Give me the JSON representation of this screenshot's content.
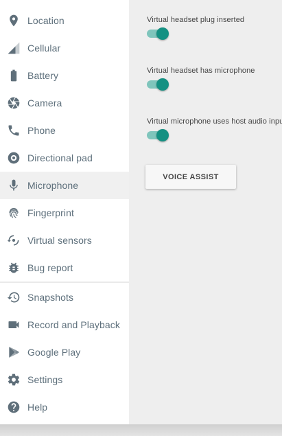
{
  "sidebar": {
    "items": [
      {
        "label": "Location"
      },
      {
        "label": "Cellular"
      },
      {
        "label": "Battery"
      },
      {
        "label": "Camera"
      },
      {
        "label": "Phone"
      },
      {
        "label": "Directional pad"
      },
      {
        "label": "Microphone",
        "selected": true
      },
      {
        "label": "Fingerprint"
      },
      {
        "label": "Virtual sensors"
      },
      {
        "label": "Bug report"
      },
      {
        "label": "Snapshots"
      },
      {
        "label": "Record and Playback"
      },
      {
        "label": "Google Play"
      },
      {
        "label": "Settings"
      },
      {
        "label": "Help"
      }
    ]
  },
  "microphone": {
    "settings": [
      {
        "label": "Virtual headset plug inserted",
        "on": true
      },
      {
        "label": "Virtual headset has microphone",
        "on": true
      },
      {
        "label": "Virtual microphone uses host audio input",
        "on": true
      }
    ],
    "voice_assist_label": "VOICE ASSIST"
  },
  "colors": {
    "accent": "#149082",
    "accent_track": "#7fc5bc",
    "sidebar_text": "#5d6f7b"
  }
}
